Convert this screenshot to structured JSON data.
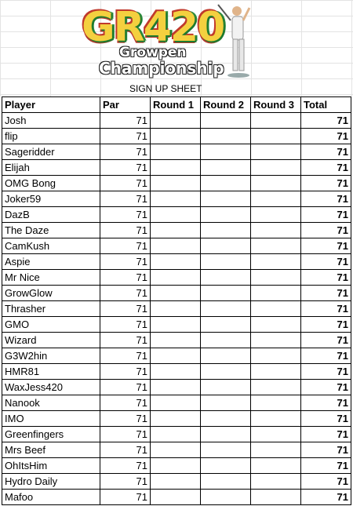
{
  "logo": {
    "title": "GR420",
    "line1": "Growpen",
    "line2": "Championship"
  },
  "sheet_title": "SIGN UP SHEET",
  "columns": [
    "Player",
    "Par",
    "Round 1",
    "Round 2",
    "Round 3",
    "Total"
  ],
  "rows": [
    {
      "player": "Josh",
      "par": "71",
      "r1": "",
      "r2": "",
      "r3": "",
      "total": "71"
    },
    {
      "player": "flip",
      "par": "71",
      "r1": "",
      "r2": "",
      "r3": "",
      "total": "71"
    },
    {
      "player": "Sageridder",
      "par": "71",
      "r1": "",
      "r2": "",
      "r3": "",
      "total": "71"
    },
    {
      "player": "Elijah",
      "par": "71",
      "r1": "",
      "r2": "",
      "r3": "",
      "total": "71"
    },
    {
      "player": "OMG Bong",
      "par": "71",
      "r1": "",
      "r2": "",
      "r3": "",
      "total": "71"
    },
    {
      "player": "Joker59",
      "par": "71",
      "r1": "",
      "r2": "",
      "r3": "",
      "total": "71"
    },
    {
      "player": "DazB",
      "par": "71",
      "r1": "",
      "r2": "",
      "r3": "",
      "total": "71"
    },
    {
      "player": "The Daze",
      "par": "71",
      "r1": "",
      "r2": "",
      "r3": "",
      "total": "71"
    },
    {
      "player": "CamKush",
      "par": "71",
      "r1": "",
      "r2": "",
      "r3": "",
      "total": "71"
    },
    {
      "player": "Aspie",
      "par": "71",
      "r1": "",
      "r2": "",
      "r3": "",
      "total": "71"
    },
    {
      "player": "Mr Nice",
      "par": "71",
      "r1": "",
      "r2": "",
      "r3": "",
      "total": "71"
    },
    {
      "player": "GrowGlow",
      "par": "71",
      "r1": "",
      "r2": "",
      "r3": "",
      "total": "71"
    },
    {
      "player": "Thrasher",
      "par": "71",
      "r1": "",
      "r2": "",
      "r3": "",
      "total": "71"
    },
    {
      "player": "GMO",
      "par": "71",
      "r1": "",
      "r2": "",
      "r3": "",
      "total": "71"
    },
    {
      "player": "Wizard",
      "par": "71",
      "r1": "",
      "r2": "",
      "r3": "",
      "total": "71"
    },
    {
      "player": "G3W2hin",
      "par": "71",
      "r1": "",
      "r2": "",
      "r3": "",
      "total": "71"
    },
    {
      "player": "HMR81",
      "par": "71",
      "r1": "",
      "r2": "",
      "r3": "",
      "total": "71"
    },
    {
      "player": "WaxJess420",
      "par": "71",
      "r1": "",
      "r2": "",
      "r3": "",
      "total": "71"
    },
    {
      "player": "Nanook",
      "par": "71",
      "r1": "",
      "r2": "",
      "r3": "",
      "total": "71"
    },
    {
      "player": "IMO",
      "par": "71",
      "r1": "",
      "r2": "",
      "r3": "",
      "total": "71"
    },
    {
      "player": "Greenfingers",
      "par": "71",
      "r1": "",
      "r2": "",
      "r3": "",
      "total": "71"
    },
    {
      "player": "Mrs Beef",
      "par": "71",
      "r1": "",
      "r2": "",
      "r3": "",
      "total": "71"
    },
    {
      "player": "OhItsHim",
      "par": "71",
      "r1": "",
      "r2": "",
      "r3": "",
      "total": "71"
    },
    {
      "player": "Hydro Daily",
      "par": "71",
      "r1": "",
      "r2": "",
      "r3": "",
      "total": "71"
    },
    {
      "player": "Mafoo",
      "par": "71",
      "r1": "",
      "r2": "",
      "r3": "",
      "total": "71"
    }
  ]
}
